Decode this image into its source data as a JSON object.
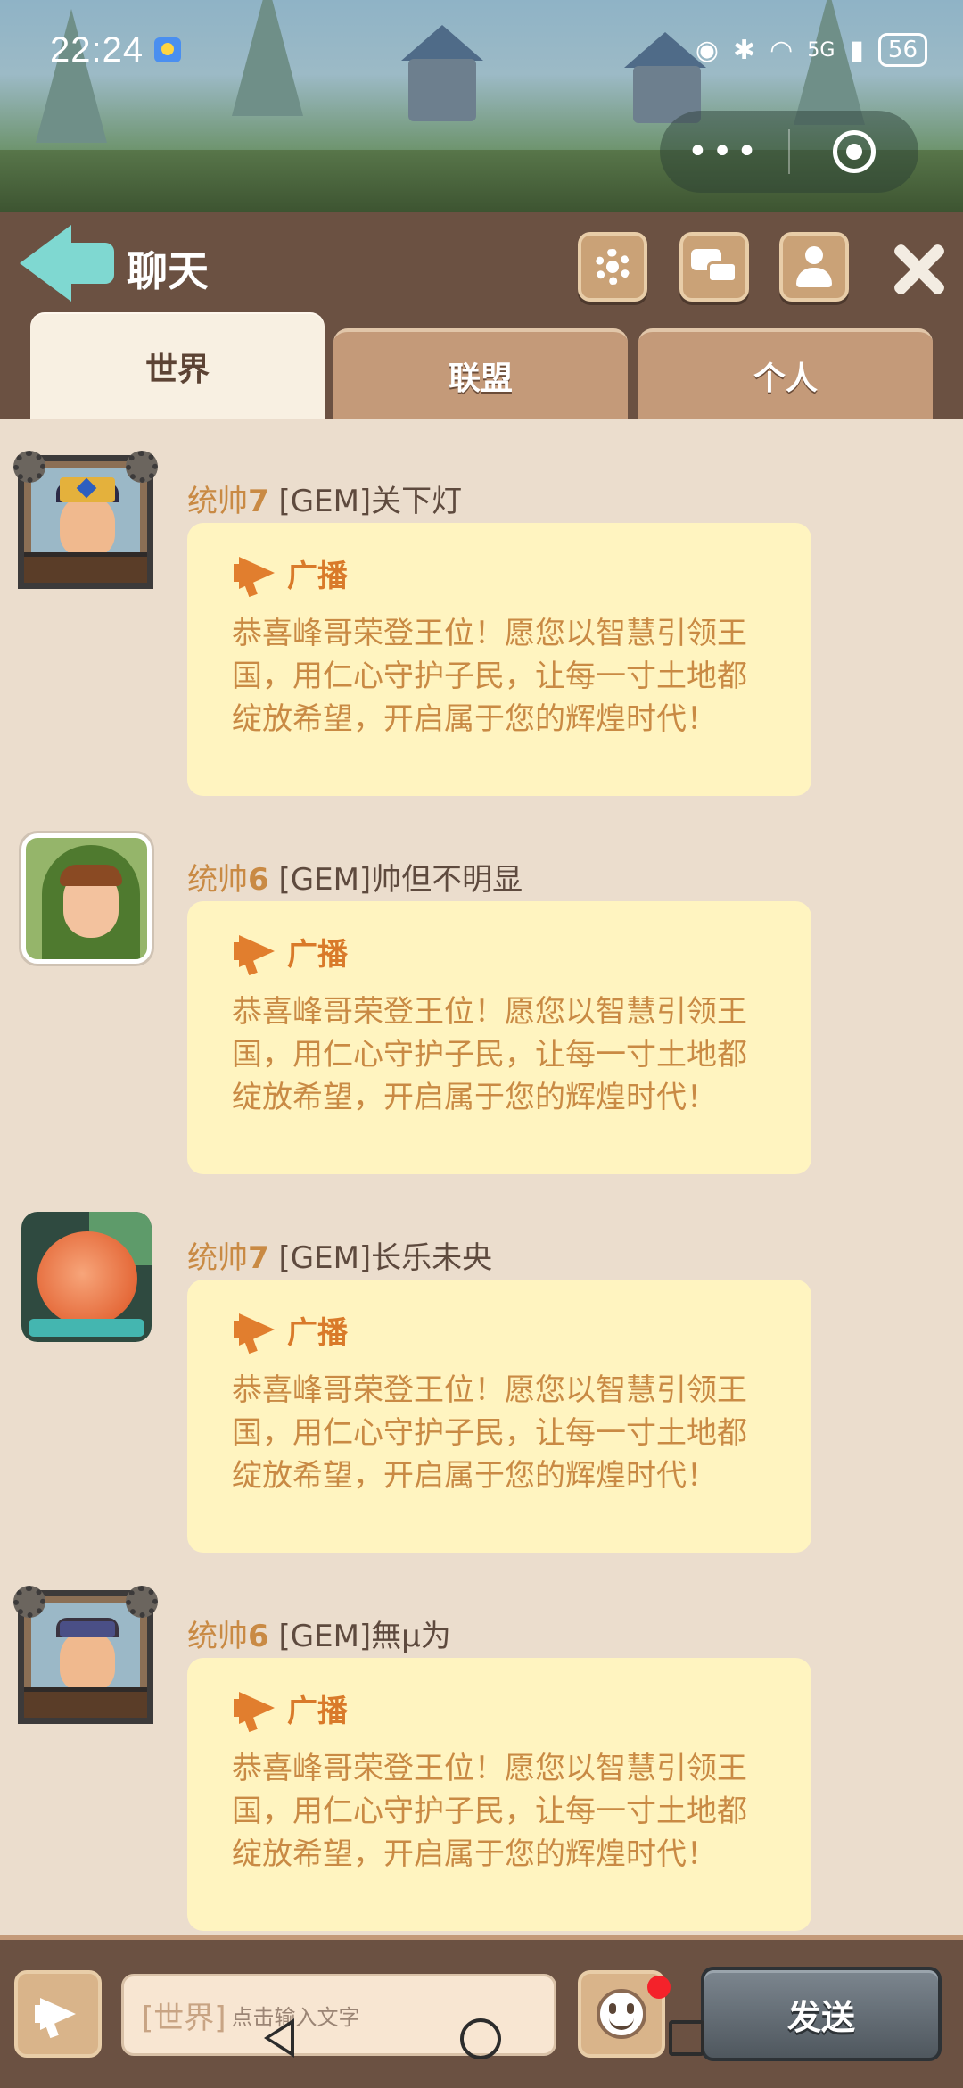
{
  "status_bar": {
    "time": "22:24",
    "network": "5G",
    "battery": "56"
  },
  "header": {
    "title": "聊天"
  },
  "tabs": [
    {
      "label": "世界",
      "active": true
    },
    {
      "label": "联盟",
      "active": false
    },
    {
      "label": "个人",
      "active": false
    }
  ],
  "messages": [
    {
      "rank_prefix": "统帅",
      "rank_level": "7",
      "name": "[GEM]关下灯",
      "avatar": "king-avatar",
      "tag": "广播",
      "text": "恭喜峰哥荣登王位！愿您以智慧引领王国，用仁心守护子民，让每一寸土地都绽放希望，开启属于您的辉煌时代！"
    },
    {
      "rank_prefix": "统帅",
      "rank_level": "6",
      "name": "[GEM]帅但不明显",
      "avatar": "hooded-avatar",
      "tag": "广播",
      "text": "恭喜峰哥荣登王位！愿您以智慧引领王国，用仁心守护子民，让每一寸土地都绽放希望，开启属于您的辉煌时代！"
    },
    {
      "rank_prefix": "统帅",
      "rank_level": "7",
      "name": "[GEM]长乐未央",
      "avatar": "orb-avatar",
      "tag": "广播",
      "text": "恭喜峰哥荣登王位！愿您以智慧引领王国，用仁心守护子民，让每一寸土地都绽放希望，开启属于您的辉煌时代！"
    },
    {
      "rank_prefix": "统帅",
      "rank_level": "6",
      "name": "[GEM]無µ为",
      "avatar": "warrior-avatar",
      "tag": "广播",
      "text": "恭喜峰哥荣登王位！愿您以智慧引领王国，用仁心守护子民，让每一寸土地都绽放希望，开启属于您的辉煌时代！"
    }
  ],
  "input_bar": {
    "channel": "[世界]",
    "placeholder": "点击输入文字",
    "send_label": "发送"
  },
  "colors": {
    "header_bg": "#6b5142",
    "content_bg": "#ebddcd",
    "bubble_bg": "#fff4c0",
    "accent_text": "#c98a44",
    "tab_active": "#f8f0e2",
    "tab_inactive": "#c49a79"
  }
}
